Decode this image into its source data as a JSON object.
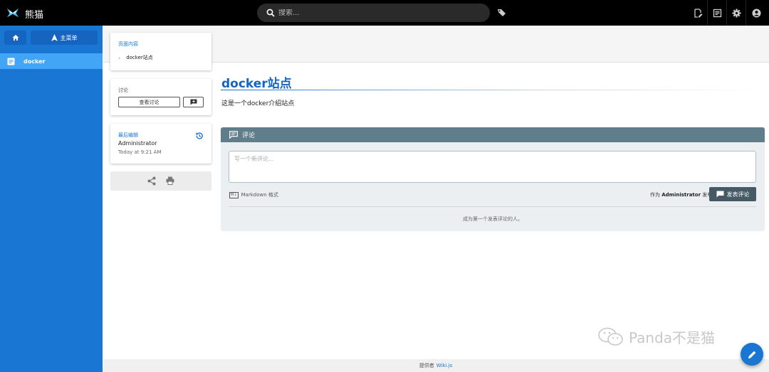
{
  "app": {
    "title": "熊猫"
  },
  "search": {
    "placeholder": "搜索..."
  },
  "toolbar": {
    "icons": [
      "tags-icon",
      "new-page-icon",
      "page-actions-icon",
      "admin-gear-icon",
      "account-icon"
    ]
  },
  "sidebar": {
    "home_icon": "home-icon",
    "menu_label": "主菜单",
    "items": [
      {
        "label": "docker",
        "icon": "page-icon"
      }
    ]
  },
  "toc": {
    "title": "页面内容",
    "items": [
      {
        "label": "docker站点"
      }
    ]
  },
  "discussion": {
    "title": "讨论",
    "view_label": "查看讨论"
  },
  "last_edit": {
    "title": "最后编辑",
    "author": "Administrator",
    "time": "Today at 9:21 AM"
  },
  "page": {
    "title": "docker站点",
    "description": "这是一个docker介绍站点"
  },
  "comments": {
    "header": "评论",
    "placeholder": "写一个新评论...",
    "markdown_badge": "M↓",
    "markdown_label": "Markdown 格式",
    "post_as_prefix": "作为",
    "post_as_user": "Administrator",
    "post_as_suffix": "发布",
    "post_button": "发表评论",
    "empty_text": "成为第一个发表评论的人。"
  },
  "footer": {
    "prefix": "提供者",
    "link": "Wiki.js"
  },
  "watermark": {
    "text": "Panda不是猫"
  },
  "colors": {
    "topbar": "#000000",
    "sidebar": "#1976d2",
    "sidebar_active": "#42a5f5",
    "accent": "#1976d2",
    "comment_bar": "#607d8b",
    "post_button": "#455a64"
  }
}
